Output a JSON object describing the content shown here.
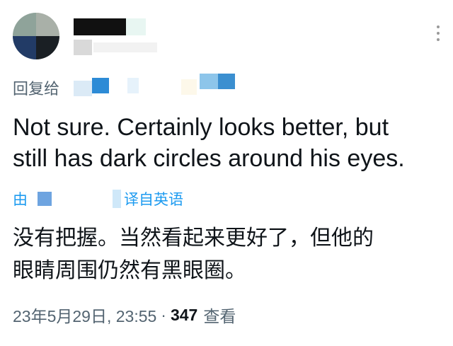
{
  "header": {
    "more_icon": "more-vertical-icon"
  },
  "reply": {
    "label": "回复给"
  },
  "tweet": {
    "text": "Not sure. Certainly looks better, but\nstill has dark circles around his eyes."
  },
  "translation_notice": {
    "by_label": "由",
    "from_label": "译自英语"
  },
  "translation": {
    "text": "没有把握。当然看起来更好了，但他的\n眼睛周围仍然有黑眼圈。"
  },
  "meta": {
    "date": "23年5月29日, 23:55",
    "separator": "·",
    "views_count": "347",
    "views_label": "查看"
  },
  "colors": {
    "text_primary": "#0f1419",
    "text_secondary": "#536471",
    "link": "#1d9bf0"
  }
}
